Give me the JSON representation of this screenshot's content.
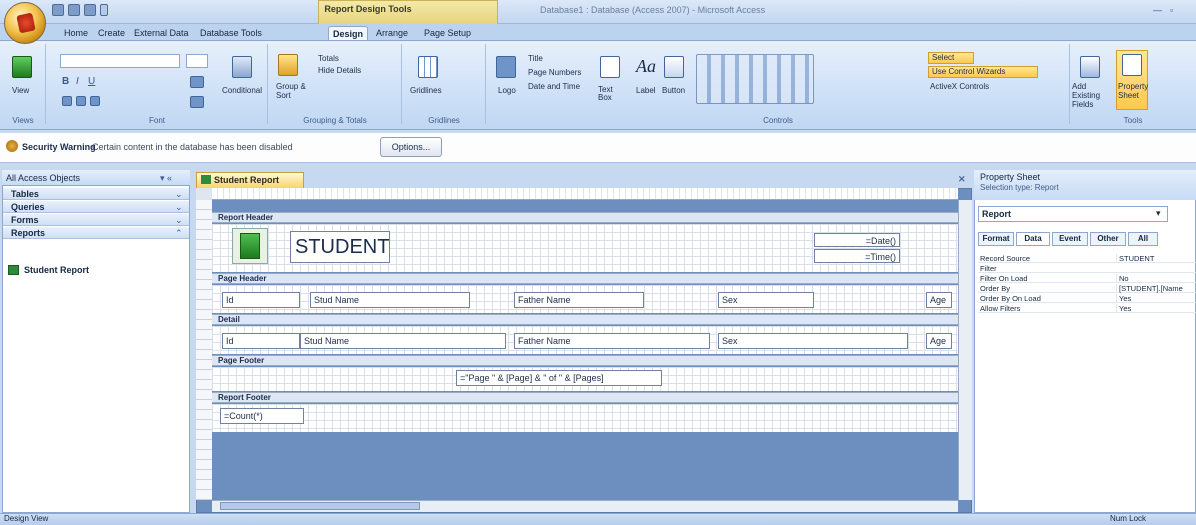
{
  "window": {
    "title": "Database1 : Database (Access 2007) - Microsoft Access",
    "context_tab": "Report Design Tools"
  },
  "tabs": [
    "Home",
    "Create",
    "External Data",
    "Database Tools",
    "Design",
    "Arrange",
    "Page Setup"
  ],
  "active_tab": "Design",
  "ribbon": {
    "groups": [
      "Views",
      "Font",
      "Grouping & Totals",
      "Gridlines",
      "Controls",
      "Tools"
    ],
    "view_label": "View",
    "conditional_label": "Conditional",
    "group_sort_label": "Group & Sort",
    "totals_label": "Totals",
    "hide_details_label": "Hide Details",
    "gridlines_label": "Gridlines",
    "logo_label": "Logo",
    "title_label": "Title",
    "page_numbers_label": "Page Numbers",
    "date_time_label": "Date and Time",
    "text_box_label": "Text Box",
    "label_label": "Label",
    "button_label": "Button",
    "select_label": "Select",
    "use_wizards_label": "Use Control Wizards",
    "activex_label": "ActiveX Controls",
    "add_fields_label": "Add Existing Fields",
    "property_sheet_label": "Property Sheet"
  },
  "message_bar": {
    "title": "Security Warning",
    "text": "Certain content in the database has been disabled",
    "button": "Options..."
  },
  "nav": {
    "title": "All Access Objects",
    "groups": [
      "Tables",
      "Queries",
      "Forms",
      "Reports"
    ],
    "item": "Student Report"
  },
  "document": {
    "tab": "Student Report",
    "sections": [
      "Report Header",
      "Page Header",
      "Detail",
      "Page Footer",
      "Report Footer"
    ],
    "report_title": "STUDENT",
    "date_field": "=Date()",
    "time_field": "=Time()",
    "page_header_labels": [
      "Id",
      "Stud Name",
      "Father Name",
      "Sex",
      "Age"
    ],
    "detail_fields": [
      "Id",
      "Stud Name",
      "Father Name",
      "Sex",
      "Age"
    ],
    "page_footer_expr": "=\"Page \" & [Page] & \" of \" & [Pages]",
    "report_footer_expr": "=Count(*)"
  },
  "property_sheet": {
    "title": "Property Sheet",
    "selection_type": "Selection type: Report",
    "selected": "Report",
    "tabs": [
      "Format",
      "Data",
      "Event",
      "Other",
      "All"
    ],
    "rows": [
      {
        "k": "Record Source",
        "v": "STUDENT"
      },
      {
        "k": "Filter",
        "v": ""
      },
      {
        "k": "Filter On Load",
        "v": "No"
      },
      {
        "k": "Order By",
        "v": "[STUDENT].[Name"
      },
      {
        "k": "Order By On Load",
        "v": "Yes"
      },
      {
        "k": "Allow Filters",
        "v": "Yes"
      }
    ]
  },
  "status": {
    "left": "Design View",
    "right": "Num Lock"
  }
}
